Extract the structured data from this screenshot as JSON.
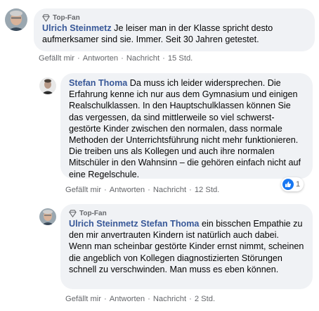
{
  "comments": [
    {
      "badge": "Top-Fan",
      "author": "Ulrich Steinmetz",
      "text": " Je leiser man in der Klasse spricht desto aufmerksamer sind sie. Immer. Seit 30 Jahren getestet.",
      "actions": {
        "like": "Gefällt mir",
        "reply": "Antworten",
        "message": "Nachricht",
        "time": "15 Std."
      }
    },
    {
      "author": "Stefan Thoma",
      "text": " Da muss ich leider widersprechen. Die Erfahrung kenne ich nur aus dem Gymnasium und einigen Realschulklassen. In den Hauptschulklassen können Sie das vergessen, da sind mittlerweile so viel schwerst-gestörte Kinder zwischen den normalen, dass normale Methoden der Unterrichtsführung nicht mehr funktionieren. Die treiben uns als Kollegen und auch ihre normalen Mitschüler in den Wahnsinn – die gehören einfach nicht auf eine Regelschule.",
      "actions": {
        "like": "Gefällt mir",
        "reply": "Antworten",
        "message": "Nachricht",
        "time": "12 Std."
      },
      "reaction": {
        "icon": "like-icon",
        "count": "1"
      }
    },
    {
      "badge": "Top-Fan",
      "author": "Ulrich Steinmetz",
      "mention": "Stefan Thoma",
      "text": " ein bisschen Empathie zu den mir anvertrauten Kindern ist natürlich auch dabei. Wenn man scheinbar gestörte Kinder ernst nimmt, scheinen die angeblich von Kollegen diagnostizierten Störungen schnell zu verschwinden. Man muss es eben können.",
      "actions": {
        "like": "Gefällt mir",
        "reply": "Antworten",
        "message": "Nachricht",
        "time": "2 Std."
      }
    }
  ],
  "colors": {
    "link": "#385898",
    "bubble": "#f0f2f5",
    "muted": "#65676b",
    "like": "#1877f2"
  }
}
